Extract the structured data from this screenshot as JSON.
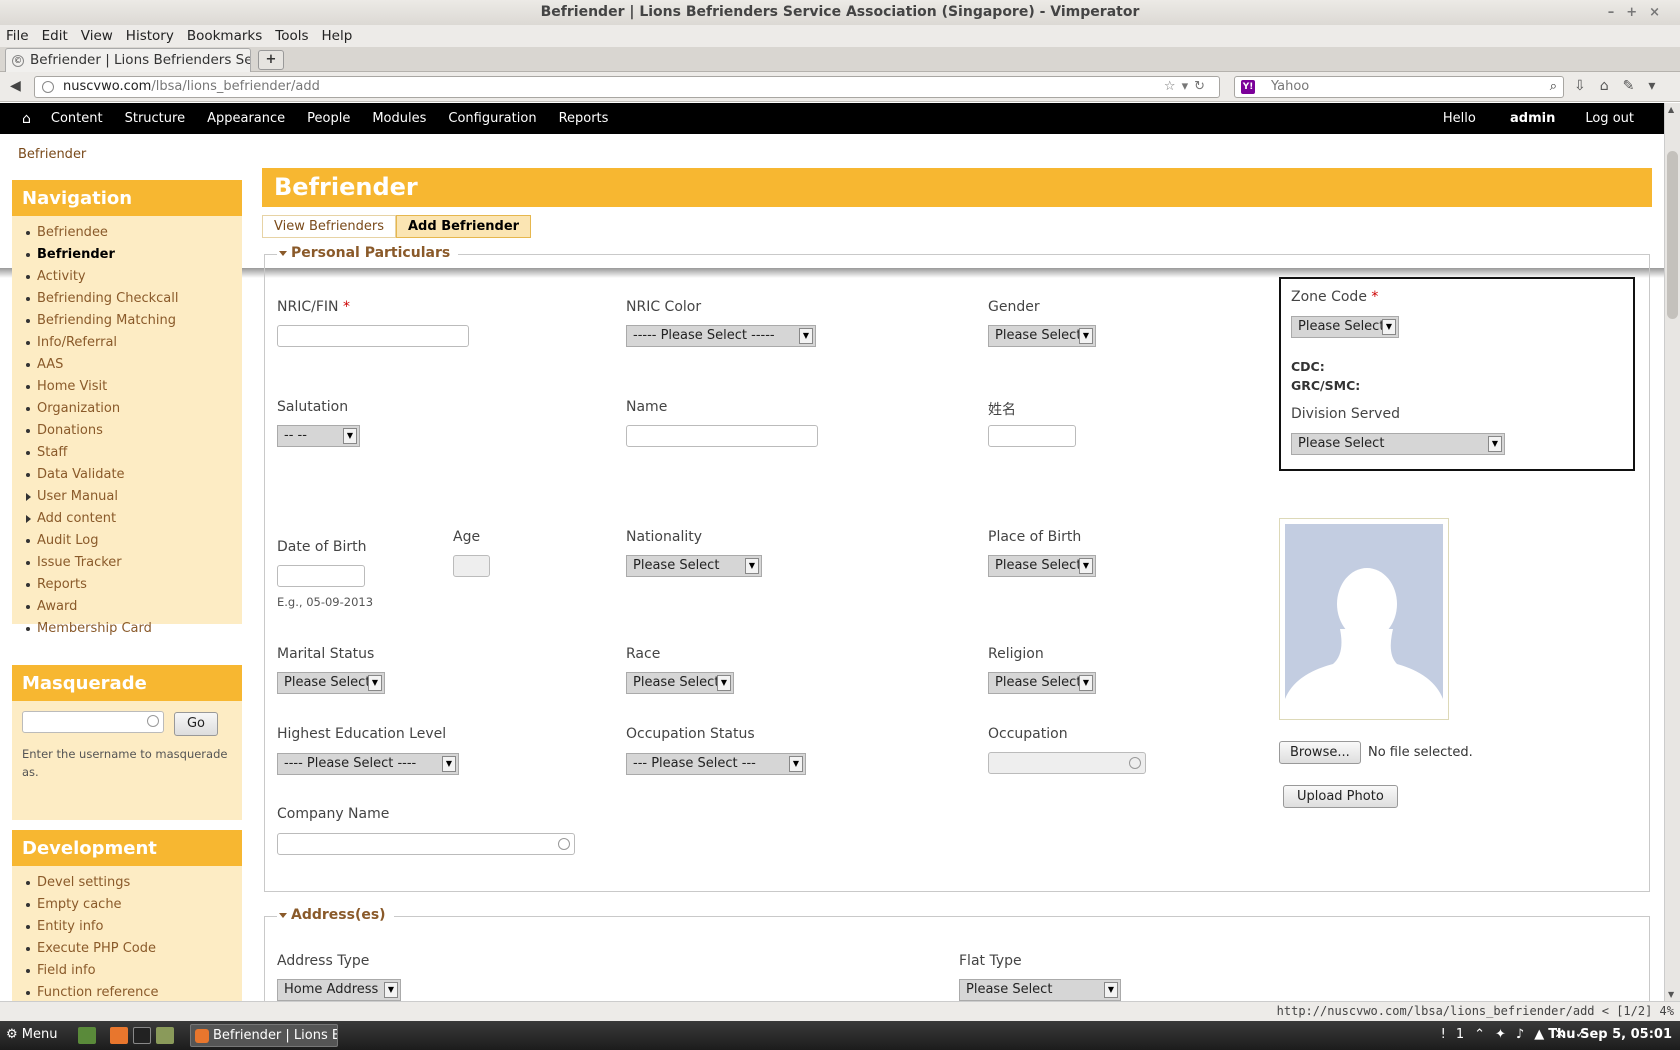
{
  "window": {
    "title": "Befriender | Lions Befrienders Service Association (Singapore) - Vimperator"
  },
  "menubar": [
    "File",
    "Edit",
    "View",
    "History",
    "Bookmarks",
    "Tools",
    "Help"
  ],
  "browser": {
    "tab_title": "Befriender | Lions Befrienders Serv...",
    "url_host": "nuscvwo.com",
    "url_path": "/lbsa/lions_befriender/add",
    "search_placeholder": "Yahoo"
  },
  "toolbar": {
    "items": [
      "Content",
      "Structure",
      "Appearance",
      "People",
      "Modules",
      "Configuration",
      "Reports"
    ],
    "hello": "Hello",
    "user": "admin",
    "logout": "Log out"
  },
  "breadcrumb": "Befriender",
  "navigation": {
    "title": "Navigation",
    "items": [
      {
        "label": "Befriendee"
      },
      {
        "label": "Befriender"
      },
      {
        "label": "Activity"
      },
      {
        "label": "Befriending Checkcall"
      },
      {
        "label": "Befriending Matching"
      },
      {
        "label": "Info/Referral"
      },
      {
        "label": "AAS"
      },
      {
        "label": "Home Visit"
      },
      {
        "label": "Organization"
      },
      {
        "label": "Donations"
      },
      {
        "label": "Staff"
      },
      {
        "label": "Data Validate"
      },
      {
        "label": "User Manual"
      },
      {
        "label": "Add content"
      },
      {
        "label": "Audit Log"
      },
      {
        "label": "Issue Tracker"
      },
      {
        "label": "Reports"
      },
      {
        "label": "Award"
      },
      {
        "label": "Membership Card"
      }
    ]
  },
  "masquerade": {
    "title": "Masquerade",
    "go": "Go",
    "help": "Enter the username to masquerade as."
  },
  "development": {
    "title": "Development",
    "items": [
      {
        "label": "Devel settings"
      },
      {
        "label": "Empty cache"
      },
      {
        "label": "Entity info"
      },
      {
        "label": "Execute PHP Code"
      },
      {
        "label": "Field info"
      },
      {
        "label": "Function reference"
      }
    ]
  },
  "main": {
    "title": "Befriender",
    "tabs": [
      "View Befrienders",
      "Add Befriender"
    ],
    "personal": {
      "legend": "Personal Particulars",
      "nric_label": "NRIC/FIN",
      "required": "*",
      "nric_color_label": "NRIC Color",
      "nric_color_value": "----- Please Select -----",
      "gender_label": "Gender",
      "gender_value": "Please Select",
      "zone_label": "Zone Code",
      "zone_value": "Please Select",
      "cdc": "CDC:",
      "grc": "GRC/SMC:",
      "division_label": "Division Served",
      "division_value": "Please Select",
      "salutation_label": "Salutation",
      "salutation_value": "-- --",
      "name_label": "Name",
      "chinese_name_label": "姓名",
      "dob_label": "Date of Birth",
      "dob_hint": "E.g., 05-09-2013",
      "age_label": "Age",
      "nationality_label": "Nationality",
      "nationality_value": "Please Select",
      "pob_label": "Place of Birth",
      "pob_value": "Please Select",
      "marital_label": "Marital Status",
      "marital_value": "Please Select",
      "race_label": "Race",
      "race_value": "Please Select",
      "religion_label": "Religion",
      "religion_value": "Please Select",
      "edu_label": "Highest Education Level",
      "edu_value": "---- Please Select ----",
      "occ_status_label": "Occupation Status",
      "occ_status_value": "--- Please Select ---",
      "occupation_label": "Occupation",
      "company_label": "Company Name",
      "browse": "Browse...",
      "no_file": "No file selected.",
      "upload": "Upload Photo"
    },
    "address": {
      "legend": "Address(es)",
      "type_label": "Address Type",
      "type_value": "Home Address",
      "flat_label": "Flat Type",
      "flat_value": "Please Select"
    }
  },
  "statusbar": "http://nuscvwo.com/lbsa/lions_befriender/add < [1/2]  4%",
  "taskbar": {
    "menu": "Menu",
    "task": "Befriender | Lions B...",
    "clock": "Thu Sep  5, 05:01"
  },
  "colors": {
    "accent": "#f7b731",
    "sidebar_bg": "#fdecc4",
    "toolbar": "#000000",
    "link": "#8a5a2a"
  }
}
